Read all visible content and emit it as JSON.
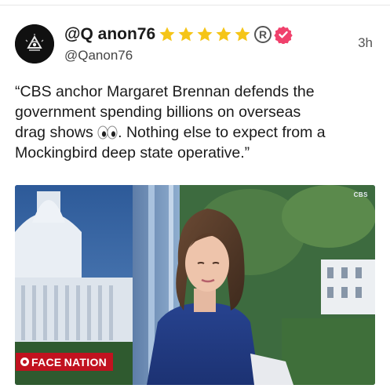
{
  "post": {
    "display_name": "@Q anon76",
    "handle": "@Qanon76",
    "timestamp": "3h",
    "star_count": 5,
    "badges": [
      "star-icon",
      "registered-icon",
      "verified-icon"
    ],
    "text_lines": [
      "“CBS anchor Margaret Brennan defends the",
      "government spending billions on overseas",
      "drag shows ",
      ". Nothing else to expect from a",
      "Mockingbird deep state operative.”"
    ],
    "emoji": "eyes-emoji"
  },
  "media": {
    "network_bug": "CBS",
    "show_logo_text": "FACE NATION"
  },
  "colors": {
    "star": "#f5c518",
    "verified": "#f0416c",
    "show_logo": "#c1121f",
    "text": "#1a1a1a",
    "muted": "#555555"
  }
}
